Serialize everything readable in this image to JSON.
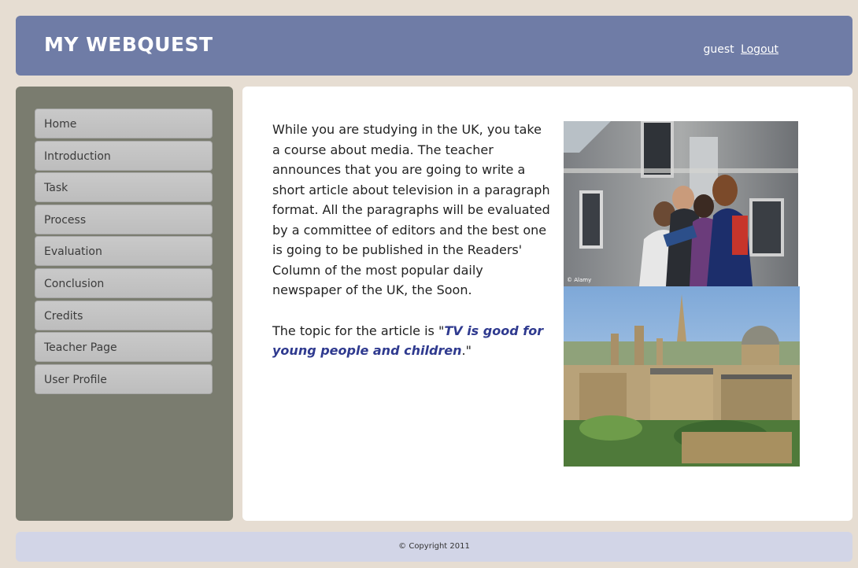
{
  "header": {
    "title": "MY WEBQUEST",
    "user": "guest",
    "logout_label": "Logout"
  },
  "sidebar": {
    "items": [
      {
        "label": "Home"
      },
      {
        "label": "Introduction"
      },
      {
        "label": "Task"
      },
      {
        "label": "Process"
      },
      {
        "label": "Evaluation"
      },
      {
        "label": "Conclusion"
      },
      {
        "label": "Credits"
      },
      {
        "label": "Teacher Page"
      },
      {
        "label": "User Profile"
      }
    ]
  },
  "main": {
    "paragraph1": "While you are studying in the UK, you take a course about media. The teacher announces that you are going to write a short article about television in a paragraph format. All the paragraphs will be evaluated by a committee of editors and the best one is going to be published in the Readers' Column of the most popular daily newspaper of the UK, the Soon.",
    "topic_prefix": "The topic for the article is \"",
    "topic": "TV is good for young people and children",
    "topic_suffix": ".\"",
    "image1_credit": "© Alamy"
  },
  "footer": {
    "copyright": "© Copyright 2011"
  },
  "colors": {
    "header_bg": "#6f7ca6",
    "sidebar_bg": "#7a7c6f",
    "footer_bg": "#d2d5e7",
    "page_bg": "#e6ddd2",
    "topic_text": "#2f3a8f"
  }
}
